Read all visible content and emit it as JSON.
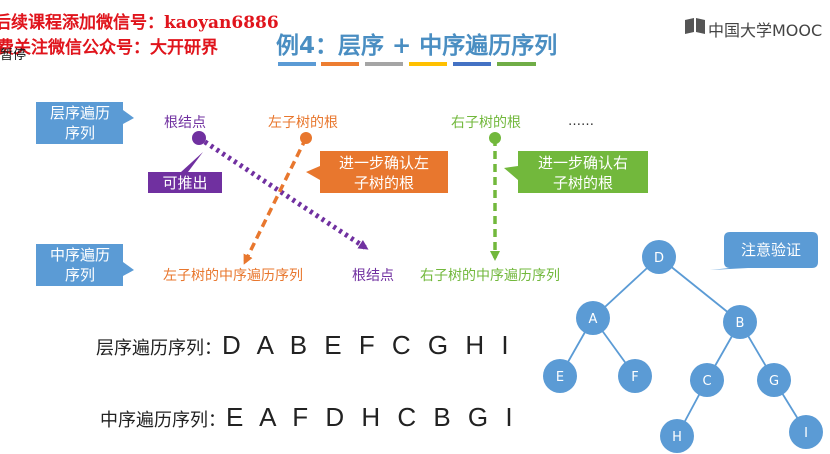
{
  "watermark": {
    "line1": "后续课程添加微信号：kaoyan6886",
    "line2": "免费关注微信公众号：大开研界",
    "paused_overlay": "暂停"
  },
  "header": {
    "title": "例4：层序 + 中序遍历序列",
    "logo_text": "中国大学MOOC",
    "color_bars": [
      "#5b9bd5",
      "#ed7d31",
      "#a5a5a5",
      "#ffc000",
      "#4472c4",
      "#70ad47"
    ]
  },
  "top_row": {
    "level_box": "层序遍历\n序列",
    "root": "根结点",
    "left_root": "左子树的根",
    "right_root": "右子树的根",
    "ellipsis": "……"
  },
  "bottom_row": {
    "inorder_box": "中序遍历\n序列",
    "left_inorder": "左子树的中序遍历序列",
    "root": "根结点",
    "right_inorder": "右子树的中序遍历序列"
  },
  "callouts": {
    "deduce": "可推出",
    "confirm_left": "进一步确认左\n子树的根",
    "confirm_right": "进一步确认右\n子树的根",
    "verify": "注意验证"
  },
  "sequences": {
    "level_label": "层序遍历序列：",
    "level_value": "D A B E F C G H I",
    "inorder_label": "中序遍历序列：",
    "inorder_value": "E A F D H C B G I"
  },
  "tree": {
    "nodes": [
      {
        "id": "D",
        "label": "D"
      },
      {
        "id": "A",
        "label": "A"
      },
      {
        "id": "B",
        "label": "B"
      },
      {
        "id": "E",
        "label": "E"
      },
      {
        "id": "F",
        "label": "F"
      },
      {
        "id": "C",
        "label": "C"
      },
      {
        "id": "G",
        "label": "G"
      },
      {
        "id": "H",
        "label": "H"
      },
      {
        "id": "I",
        "label": "I"
      }
    ],
    "edges": [
      [
        "D",
        "A"
      ],
      [
        "D",
        "B"
      ],
      [
        "A",
        "E"
      ],
      [
        "A",
        "F"
      ],
      [
        "B",
        "C"
      ],
      [
        "B",
        "G"
      ],
      [
        "C",
        "H"
      ],
      [
        "G",
        "I"
      ]
    ]
  },
  "colors": {
    "blue": "#5b9bd5",
    "orange": "#e8772e",
    "green": "#72b83c",
    "purple": "#7030a0",
    "node": "#5b9bd5"
  }
}
